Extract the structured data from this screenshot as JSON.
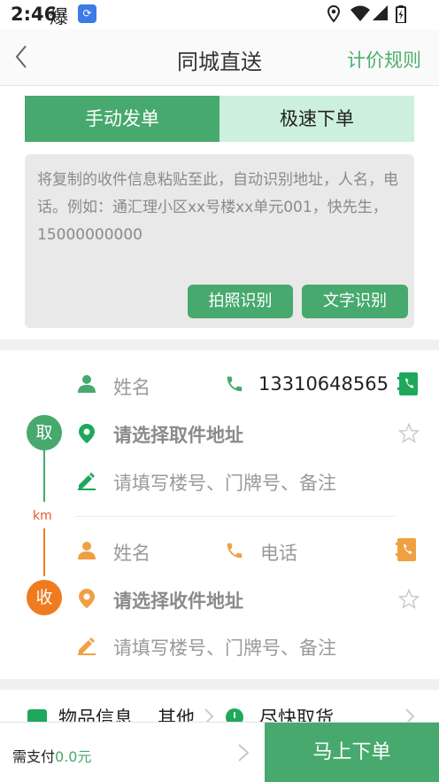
{
  "status_bar": {
    "time": "2:46",
    "glyph": "爆"
  },
  "navbar": {
    "title": "同城直送",
    "rules_link": "计价规则"
  },
  "tabs": [
    {
      "label": "手动发单",
      "active": true
    },
    {
      "label": "极速下单",
      "active": false
    }
  ],
  "paste_box": {
    "placeholder": "将复制的收件信息粘贴至此，自动识别地址，人名，电话。例如：通汇理小区xx号楼xx单元001，快先生，15000000000",
    "photo_button": "拍照识别",
    "text_button": "文字识别"
  },
  "pickup": {
    "badge": "取",
    "name_placeholder": "姓名",
    "phone": "13310648565",
    "address_placeholder": "请选择取件地址",
    "detail_placeholder": "请填写楼号、门牌号、备注",
    "color": "#47a96d"
  },
  "distance_unit": "km",
  "receive": {
    "badge": "收",
    "name_placeholder": "姓名",
    "phone_placeholder": "电话",
    "address_placeholder": "请选择收件地址",
    "detail_placeholder": "请填写楼号、门牌号、备注",
    "color": "#f07b1e"
  },
  "goods": {
    "label": "物品信息",
    "value": "其他",
    "pickup_time": "尽快取货"
  },
  "bottom_bar": {
    "pay_label": "需支付",
    "amount": "0.0元",
    "submit": "马上下单"
  }
}
